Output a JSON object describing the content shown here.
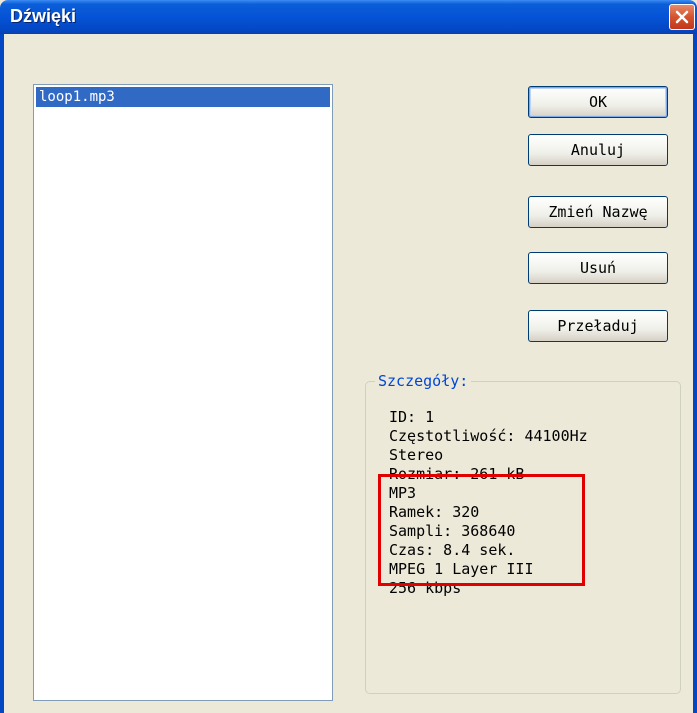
{
  "window": {
    "title": "Dźwięki",
    "close_icon": "close-icon"
  },
  "list": {
    "items": [
      {
        "label": "loop1.mp3",
        "selected": true
      }
    ]
  },
  "buttons": {
    "ok": "OK",
    "cancel": "Anuluj",
    "rename": "Zmień Nazwę",
    "delete": "Usuń",
    "reload": "Przeładuj"
  },
  "details": {
    "legend": "Szczegóły:",
    "lines": [
      "ID: 1",
      "Częstotliwość: 44100Hz",
      "Stereo",
      "Rozmiar: 261 kB",
      "MP3",
      "Ramek: 320",
      "Sampli: 368640",
      "Czas: 8.4 sek.",
      "MPEG 1 Layer III",
      "256 kbps"
    ]
  },
  "colors": {
    "titlebar": "#0553d6",
    "selection": "#316ac5",
    "highlight_box": "#e00000",
    "legend_text": "#0046d5"
  }
}
